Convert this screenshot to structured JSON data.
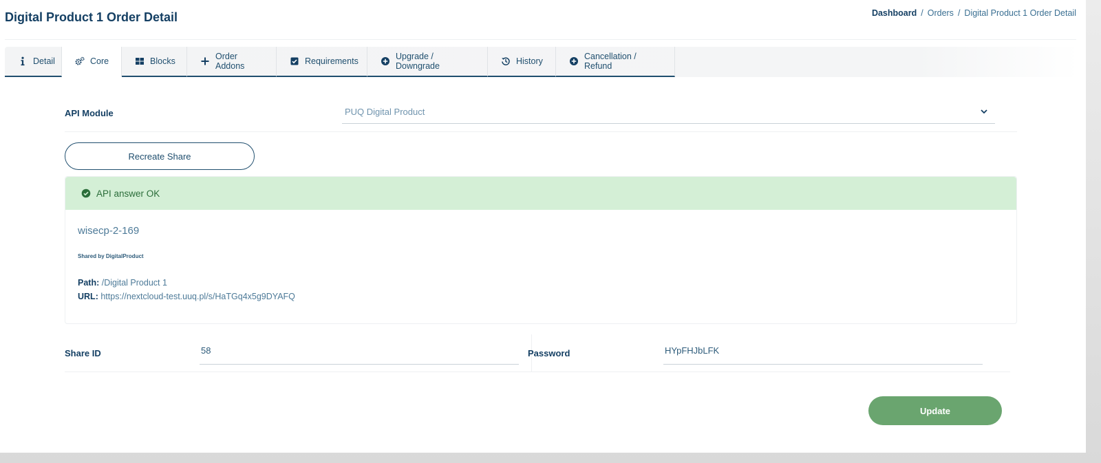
{
  "page": {
    "title": "Digital Product 1 Order Detail"
  },
  "breadcrumb": {
    "home": "Dashboard",
    "sep": "/",
    "orders": "Orders",
    "current": "Digital Product 1 Order Detail"
  },
  "tabs": [
    {
      "label": "Detail",
      "icon": "info-icon"
    },
    {
      "label": "Core",
      "icon": "gears-icon",
      "active": true
    },
    {
      "label": "Blocks",
      "icon": "th-large-icon"
    },
    {
      "label": "Order Addons",
      "icon": "plus-icon"
    },
    {
      "label": "Requirements",
      "icon": "check-square-icon"
    },
    {
      "label": "Upgrade / Downgrade",
      "icon": "plus-circle-icon"
    },
    {
      "label": "History",
      "icon": "history-icon"
    },
    {
      "label": "Cancellation / Refund",
      "icon": "plus-circle-icon"
    }
  ],
  "api_module": {
    "label": "API Module",
    "selected": "PUQ Digital Product"
  },
  "actions": {
    "recreate_label": "Recreate Share",
    "update_label": "Update"
  },
  "result": {
    "alert": "API answer OK",
    "share_name": "wisecp-2-169",
    "shared_by": "Shared by DigitalProduct",
    "path_label": "Path:",
    "path_value": "/Digital Product 1",
    "url_label": "URL:",
    "url_value": "https://nextcloud-test.uuq.pl/s/HaTGq4x5g9DYAFQ"
  },
  "fields": {
    "share_id_label": "Share ID",
    "share_id_value": "58",
    "password_label": "Password",
    "password_value": "HYpFHJbLFK"
  },
  "colors": {
    "primary": "#143f63",
    "alert_bg": "#d4efd6",
    "update_button": "#6aa56f"
  }
}
